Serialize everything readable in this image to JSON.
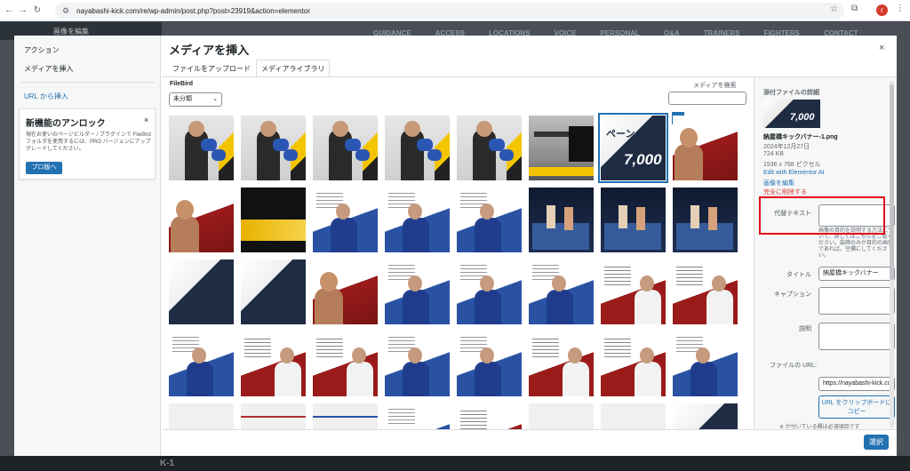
{
  "browser": {
    "url": "nayabashi-kick.com/re/wp-admin/post.php?post=23919&action=elementor"
  },
  "background": {
    "left_label": "画像を編集",
    "nav": [
      "GUIDANCE",
      "ACCESS",
      "LOCATIONS",
      "VOICE",
      "PERSONAL",
      "Q&A",
      "TRAINERS",
      "FIGHTERS",
      "CONTACT"
    ],
    "bottom_text": "K-1"
  },
  "modal": {
    "title": "メディアを挿入",
    "close": "×",
    "left": {
      "heading": "アクション",
      "active_item": "メディアを挿入",
      "url_link": "URL から挿入",
      "unlock": {
        "title": "新機能のアンロック",
        "description": "現在お使いのページビルダー / プラグインで FileBird フォルダを使用するには、PRO バージョンにアップグレードしてください。",
        "button": "プロ版へ",
        "close": "×"
      }
    },
    "tabs": [
      "ファイルをアップロード",
      "メディアライブラリ"
    ],
    "filebird_label": "FileBird",
    "filebird_select": "未分類",
    "search_label": "メディアを検索",
    "search_value": "",
    "details": {
      "heading": "添付ファイルの詳細",
      "thumb_text": "7,000",
      "filename": "納屋橋キックバナー-1.png",
      "date": "2024年12月27日",
      "size": "724 KB",
      "dimensions": "1536 x 768 ピクセル",
      "edit_elementor": "Edit with Elementor AI",
      "edit_image": "画像を編集",
      "delete": "完全に削除する",
      "alt_label": "代替テキスト",
      "alt_value": "",
      "alt_help": "画像の目的を説明する方法について、詳しくはこちらをご覧ください。装飾のみが目的の画像であれば、空欄にしてください。",
      "title_label": "タイトル",
      "title_value": "納屋橋キックバナー",
      "caption_label": "キャプション",
      "caption_value": "",
      "description_label": "説明",
      "description_value": "",
      "url_label": "ファイルの URL:",
      "url_value": "https://nayabashi-kick.co",
      "copy_button": "URL をクリップボードにコピー",
      "footnote": "※ が付いている欄は必須項目です"
    },
    "select_button": "選択",
    "check": "✓"
  }
}
